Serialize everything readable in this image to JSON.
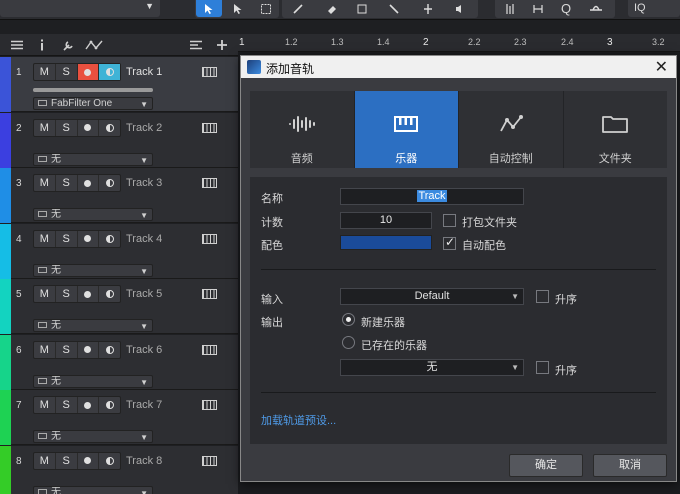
{
  "toolbar": {
    "search_text": "IQ",
    "icons": [
      "pointer-tool-icon",
      "range-tool-icon",
      "split-tool-icon",
      "eraser-tool-icon",
      "paint-tool-icon",
      "mute-tool-icon",
      "bend-tool-icon",
      "listen-tool-icon",
      "snap-icon",
      "quantize-icon",
      "q-icon",
      "hat-icon"
    ]
  },
  "ruler": {
    "ticks": [
      "1",
      "1.2",
      "1.3",
      "1.4",
      "2",
      "2.2",
      "2.3",
      "2.4",
      "3",
      "3.2"
    ]
  },
  "tracks": [
    {
      "number": "1",
      "mute": "M",
      "solo": "S",
      "name": "Track 1",
      "instrument": "FabFilter One",
      "color": "#3b54d8",
      "selected": true,
      "record_armed": true,
      "monitor_on": true
    },
    {
      "number": "2",
      "mute": "M",
      "solo": "S",
      "name": "Track 2",
      "instrument": "无",
      "color": "#3b3fe0",
      "selected": false,
      "record_armed": false,
      "monitor_on": false
    },
    {
      "number": "3",
      "mute": "M",
      "solo": "S",
      "name": "Track 3",
      "instrument": "无",
      "color": "#1f8ee6",
      "selected": false,
      "record_armed": false,
      "monitor_on": false
    },
    {
      "number": "4",
      "mute": "M",
      "solo": "S",
      "name": "Track 4",
      "instrument": "无",
      "color": "#15bde6",
      "selected": false,
      "record_armed": false,
      "monitor_on": false
    },
    {
      "number": "5",
      "mute": "M",
      "solo": "S",
      "name": "Track 5",
      "instrument": "无",
      "color": "#13d3c0",
      "selected": false,
      "record_armed": false,
      "monitor_on": false
    },
    {
      "number": "6",
      "mute": "M",
      "solo": "S",
      "name": "Track 6",
      "instrument": "无",
      "color": "#16d48a",
      "selected": false,
      "record_armed": false,
      "monitor_on": false
    },
    {
      "number": "7",
      "mute": "M",
      "solo": "S",
      "name": "Track 7",
      "instrument": "无",
      "color": "#1ed253",
      "selected": false,
      "record_armed": false,
      "monitor_on": false
    },
    {
      "number": "8",
      "mute": "M",
      "solo": "S",
      "name": "Track 8",
      "instrument": "无",
      "color": "#34cc27",
      "selected": false,
      "record_armed": false,
      "monitor_on": false
    }
  ],
  "dialog": {
    "title": "添加音轨",
    "tabs": [
      {
        "label": "音频",
        "icon": "waveform-icon",
        "active": false
      },
      {
        "label": "乐器",
        "icon": "keyboard-icon",
        "active": true
      },
      {
        "label": "自动控制",
        "icon": "automation-icon",
        "active": false
      },
      {
        "label": "文件夹",
        "icon": "folder-icon",
        "active": false
      }
    ],
    "name_label": "名称",
    "name_value": "Track",
    "count_label": "计数",
    "count_value": "10",
    "pack_folder_label": "打包文件夹",
    "pack_folder_checked": false,
    "color_label": "配色",
    "color_value": "#1a4b9a",
    "auto_color_label": "自动配色",
    "auto_color_checked": true,
    "input_label": "输入",
    "input_value": "Default",
    "input_ascending_label": "升序",
    "input_ascending_checked": false,
    "output_label": "输出",
    "new_instrument_label": "新建乐器",
    "new_instrument_selected": true,
    "existing_instrument_label": "已存在的乐器",
    "existing_instrument_selected": false,
    "output_value": "无",
    "output_ascending_label": "升序",
    "output_ascending_checked": false,
    "load_preset_link": "加载轨道预设...",
    "ok_label": "确定",
    "cancel_label": "取消",
    "close_glyph": "✕"
  }
}
